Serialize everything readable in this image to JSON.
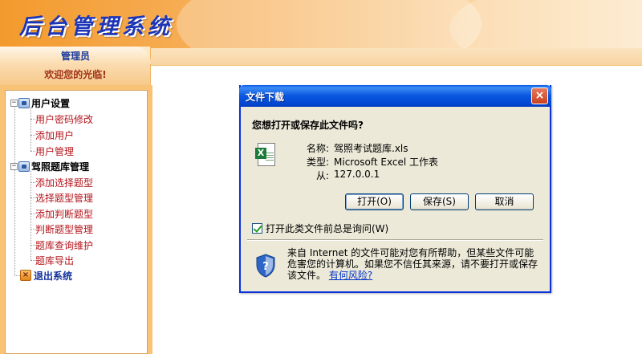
{
  "app": {
    "system_title": "后台管理系统"
  },
  "sidebar": {
    "role": "管理员",
    "welcome": "欢迎您的光临!",
    "groups": [
      {
        "label": "用户设置",
        "items": [
          "用户密码修改",
          "添加用户",
          "用户管理"
        ]
      },
      {
        "label": "驾照题库管理",
        "items": [
          "添加选择题型",
          "选择题型管理",
          "添加判断题型",
          "判断题型管理",
          "题库查询维护",
          "题库导出"
        ]
      }
    ],
    "exit_label": "退出系统"
  },
  "dialog": {
    "title": "文件下载",
    "close_symbol": "×",
    "question": "您想打开或保存此文件吗?",
    "file": {
      "name_label": "名称:",
      "name_value": "驾照考试题库.xls",
      "type_label": "类型:",
      "type_value": "Microsoft Excel 工作表",
      "from_label": "从:",
      "from_value": "127.0.0.1",
      "icon": "excel-file-icon"
    },
    "buttons": {
      "open": "打开(O)",
      "save": "保存(S)",
      "cancel": "取消"
    },
    "always_ask": {
      "label": "打开此类文件前总是询问(W)",
      "checked": true
    },
    "warning": {
      "text": "来自 Internet 的文件可能对您有所帮助，但某些文件可能危害您的计算机。如果您不信任其来源，请不要打开或保存该文件。",
      "link": "有何风险?",
      "icon": "security-shield-icon"
    }
  },
  "colors": {
    "banner_orange": "#f39a2d",
    "title_blue": "#1d36b8",
    "menu_red": "#b3141b",
    "xp_titlebar": "#0a56e0",
    "dialog_bg": "#ece9d8"
  }
}
